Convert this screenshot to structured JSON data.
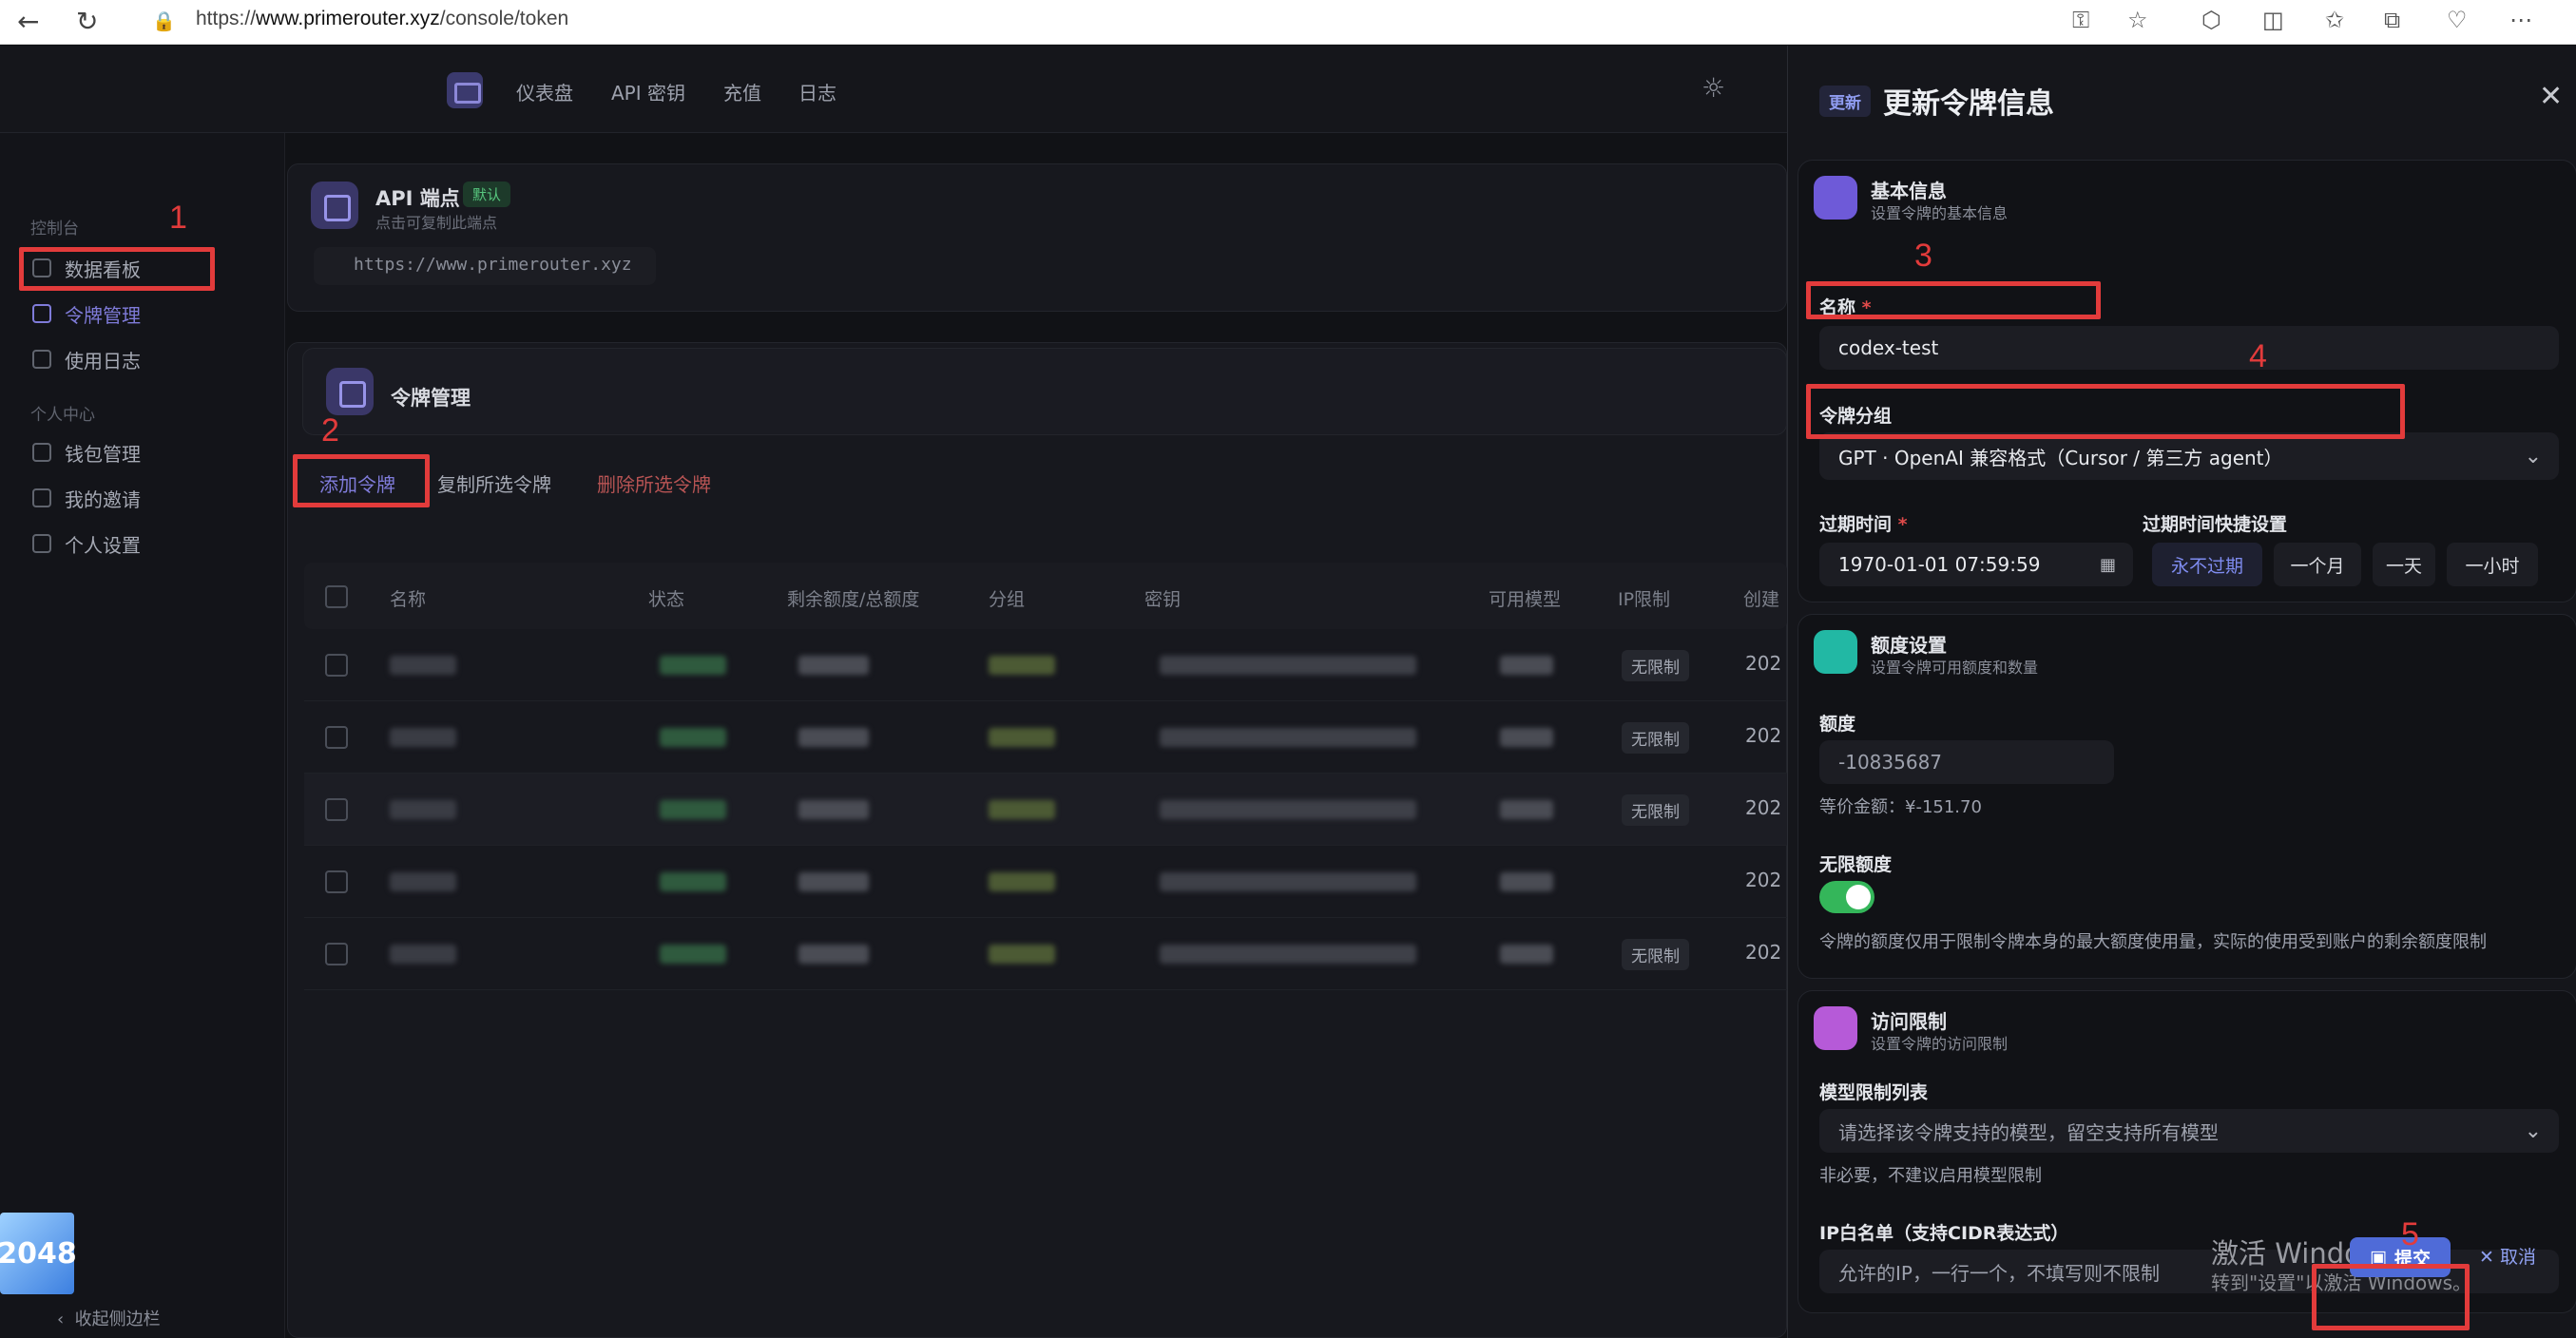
{
  "browser": {
    "url_prefix": "https://",
    "url_host": "www.primerouter.xyz",
    "url_path": "/console/token"
  },
  "topnav": [
    "仪表盘",
    "API 密钥",
    "充值",
    "日志"
  ],
  "sidebar": {
    "group1": "控制台",
    "items1": [
      "数据看板",
      "令牌管理",
      "使用日志"
    ],
    "group2": "个人中心",
    "items2": [
      "钱包管理",
      "我的邀请",
      "个人设置"
    ],
    "collapse": "收起侧边栏",
    "game": "2048"
  },
  "endpoint": {
    "title": "API 端点",
    "badge": "默认",
    "subtitle": "点击可复制此端点",
    "url": "https://www.primerouter.xyz"
  },
  "tokens": {
    "title": "令牌管理",
    "actions": [
      "添加令牌",
      "复制所选令牌",
      "删除所选令牌"
    ],
    "columns": [
      "名称",
      "状态",
      "剩余额度/总额度",
      "分组",
      "密钥",
      "可用模型",
      "IP限制",
      "创建"
    ],
    "rows": [
      {
        "ip": "无限制",
        "year": "202"
      },
      {
        "ip": "无限制",
        "year": "202"
      },
      {
        "ip": "无限制",
        "year": "202"
      },
      {
        "ip": "",
        "year": "202"
      },
      {
        "ip": "无限制",
        "year": "202"
      }
    ]
  },
  "annotations": [
    "1",
    "2",
    "3",
    "4",
    "5"
  ],
  "sheet": {
    "badge": "更新",
    "title": "更新令牌信息",
    "basic": {
      "title": "基本信息",
      "subtitle": "设置令牌的基本信息",
      "name_label": "名称",
      "name_value": "codex-test",
      "group_label": "令牌分组",
      "group_value": "GPT · OpenAI 兼容格式（Cursor / 第三方 agent）",
      "expire_label": "过期时间",
      "expire_value": "1970-01-01 07:59:59",
      "quick_label": "过期时间快捷设置",
      "quick_options": [
        "永不过期",
        "一个月",
        "一天",
        "一小时"
      ]
    },
    "quota": {
      "title": "额度设置",
      "subtitle": "设置令牌可用额度和数量",
      "amount_label": "额度",
      "amount_value": "-10835687",
      "equiv": "等价金额：¥-151.70",
      "unlimited_label": "无限额度",
      "unlimited_on": true,
      "note": "令牌的额度仅用于限制令牌本身的最大额度使用量，实际的使用受到账户的剩余额度限制"
    },
    "access": {
      "title": "访问限制",
      "subtitle": "设置令牌的访问限制",
      "models_label": "模型限制列表",
      "models_placeholder": "请选择该令牌支持的模型，留空支持所有模型",
      "models_hint": "非必要，不建议启用模型限制",
      "ip_label": "IP白名单（支持CIDR表达式）",
      "ip_placeholder": "允许的IP，一行一个，不填写则不限制"
    },
    "submit": "提交",
    "cancel": "取消"
  },
  "watermark": {
    "line1": "激活 Windows",
    "line2": "转到\"设置\"以激活 Windows。"
  }
}
